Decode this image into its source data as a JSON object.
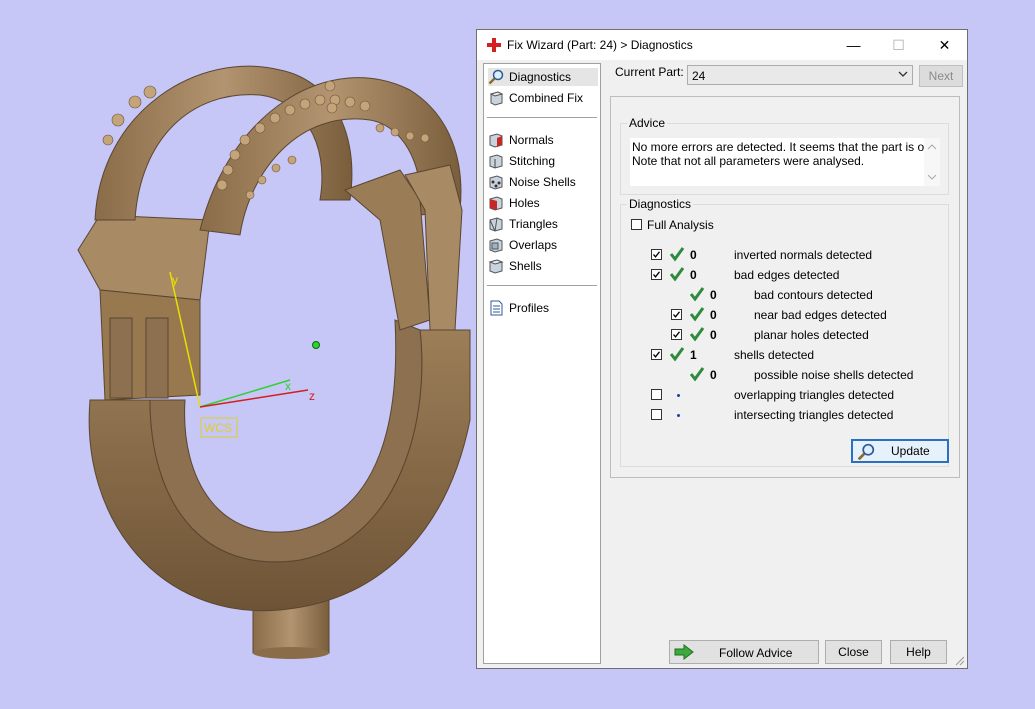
{
  "window": {
    "title": "Fix Wizard (Part: 24) > Diagnostics",
    "minimize_glyph": "—",
    "maximize_glyph": "☐",
    "close_glyph": "✕"
  },
  "nav": {
    "items": [
      {
        "label": "Diagnostics",
        "icon": "magnifier-icon"
      },
      {
        "label": "Combined Fix",
        "icon": "cube-icon"
      },
      {
        "label": "Normals",
        "icon": "normals-cube-icon"
      },
      {
        "label": "Stitching",
        "icon": "stitching-cube-icon"
      },
      {
        "label": "Noise Shells",
        "icon": "noise-shells-icon"
      },
      {
        "label": "Holes",
        "icon": "holes-cube-icon"
      },
      {
        "label": "Triangles",
        "icon": "triangles-cube-icon"
      },
      {
        "label": "Overlaps",
        "icon": "overlaps-cube-icon"
      },
      {
        "label": "Shells",
        "icon": "shells-cube-icon"
      },
      {
        "label": "Profiles",
        "icon": "document-icon"
      }
    ]
  },
  "header": {
    "current_part_label": "Current Part:",
    "current_part_value": "24",
    "next_label": "Next"
  },
  "advice": {
    "title": "Advice",
    "line1": "No more errors are detected. It seems that the part is ok.",
    "line2": "Note that not all parameters were analysed."
  },
  "diagnostics": {
    "title": "Diagnostics",
    "full_analysis_label": "Full Analysis",
    "rows": [
      {
        "count": "0",
        "label": "inverted normals detected",
        "checked": true
      },
      {
        "count": "0",
        "label": "bad edges detected",
        "checked": true
      },
      {
        "count": "0",
        "label": "bad contours detected",
        "checked": false
      },
      {
        "count": "0",
        "label": "near bad edges detected",
        "checked": true
      },
      {
        "count": "0",
        "label": "planar holes detected",
        "checked": true
      },
      {
        "count": "1",
        "label": "shells detected",
        "checked": true
      },
      {
        "count": "0",
        "label": "possible noise shells detected",
        "checked": false
      },
      {
        "count": "",
        "label": "overlapping triangles detected",
        "checked": false
      },
      {
        "count": "",
        "label": "intersecting triangles detected",
        "checked": false
      }
    ],
    "update_label": "Update"
  },
  "footer": {
    "follow_advice_label": "Follow Advice",
    "close_label": "Close",
    "help_label": "Help"
  },
  "viewport": {
    "axis_y": "y",
    "axis_x": "x",
    "axis_z": "z",
    "wcs_label": "WCS"
  },
  "colors": {
    "background": "#c6c6f7",
    "bronze": "#a0845c",
    "check_green": "#2e8b3e",
    "accent_blue": "#2b6fc1"
  }
}
